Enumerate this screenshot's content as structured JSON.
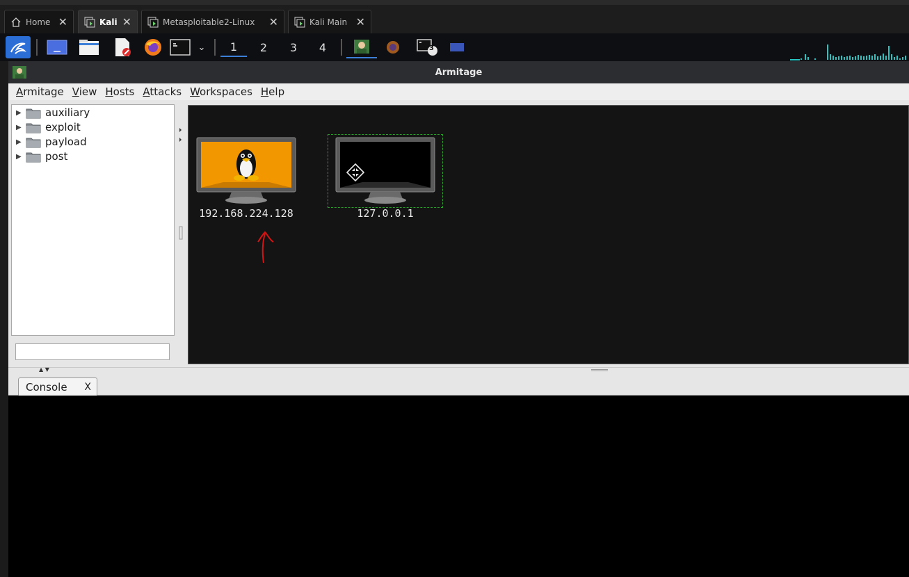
{
  "vm_tabs": [
    {
      "label": "Home",
      "active": false
    },
    {
      "label": "Kali",
      "active": true
    },
    {
      "label": "Metasploitable2-Linux",
      "active": false
    },
    {
      "label": "Kali Main",
      "active": false
    }
  ],
  "taskbar": {
    "workspaces": [
      "1",
      "2",
      "3",
      "4"
    ],
    "terminal_badge": "3"
  },
  "window": {
    "title": "Armitage"
  },
  "menu": [
    "Armitage",
    "View",
    "Hosts",
    "Attacks",
    "Workspaces",
    "Help"
  ],
  "modules": [
    "auxiliary",
    "exploit",
    "payload",
    "post"
  ],
  "module_search": {
    "value": ""
  },
  "hosts": [
    {
      "ip": "192.168.224.128",
      "os": "linux"
    },
    {
      "ip": "127.0.0.1",
      "os": "unknown"
    }
  ],
  "console": {
    "tab_label": "Console",
    "close_label": "X"
  },
  "colors": {
    "graph_bg": "#141414",
    "linux_screen": "#f29700",
    "annotation": "#d41414",
    "accent": "#3b7fd8"
  }
}
